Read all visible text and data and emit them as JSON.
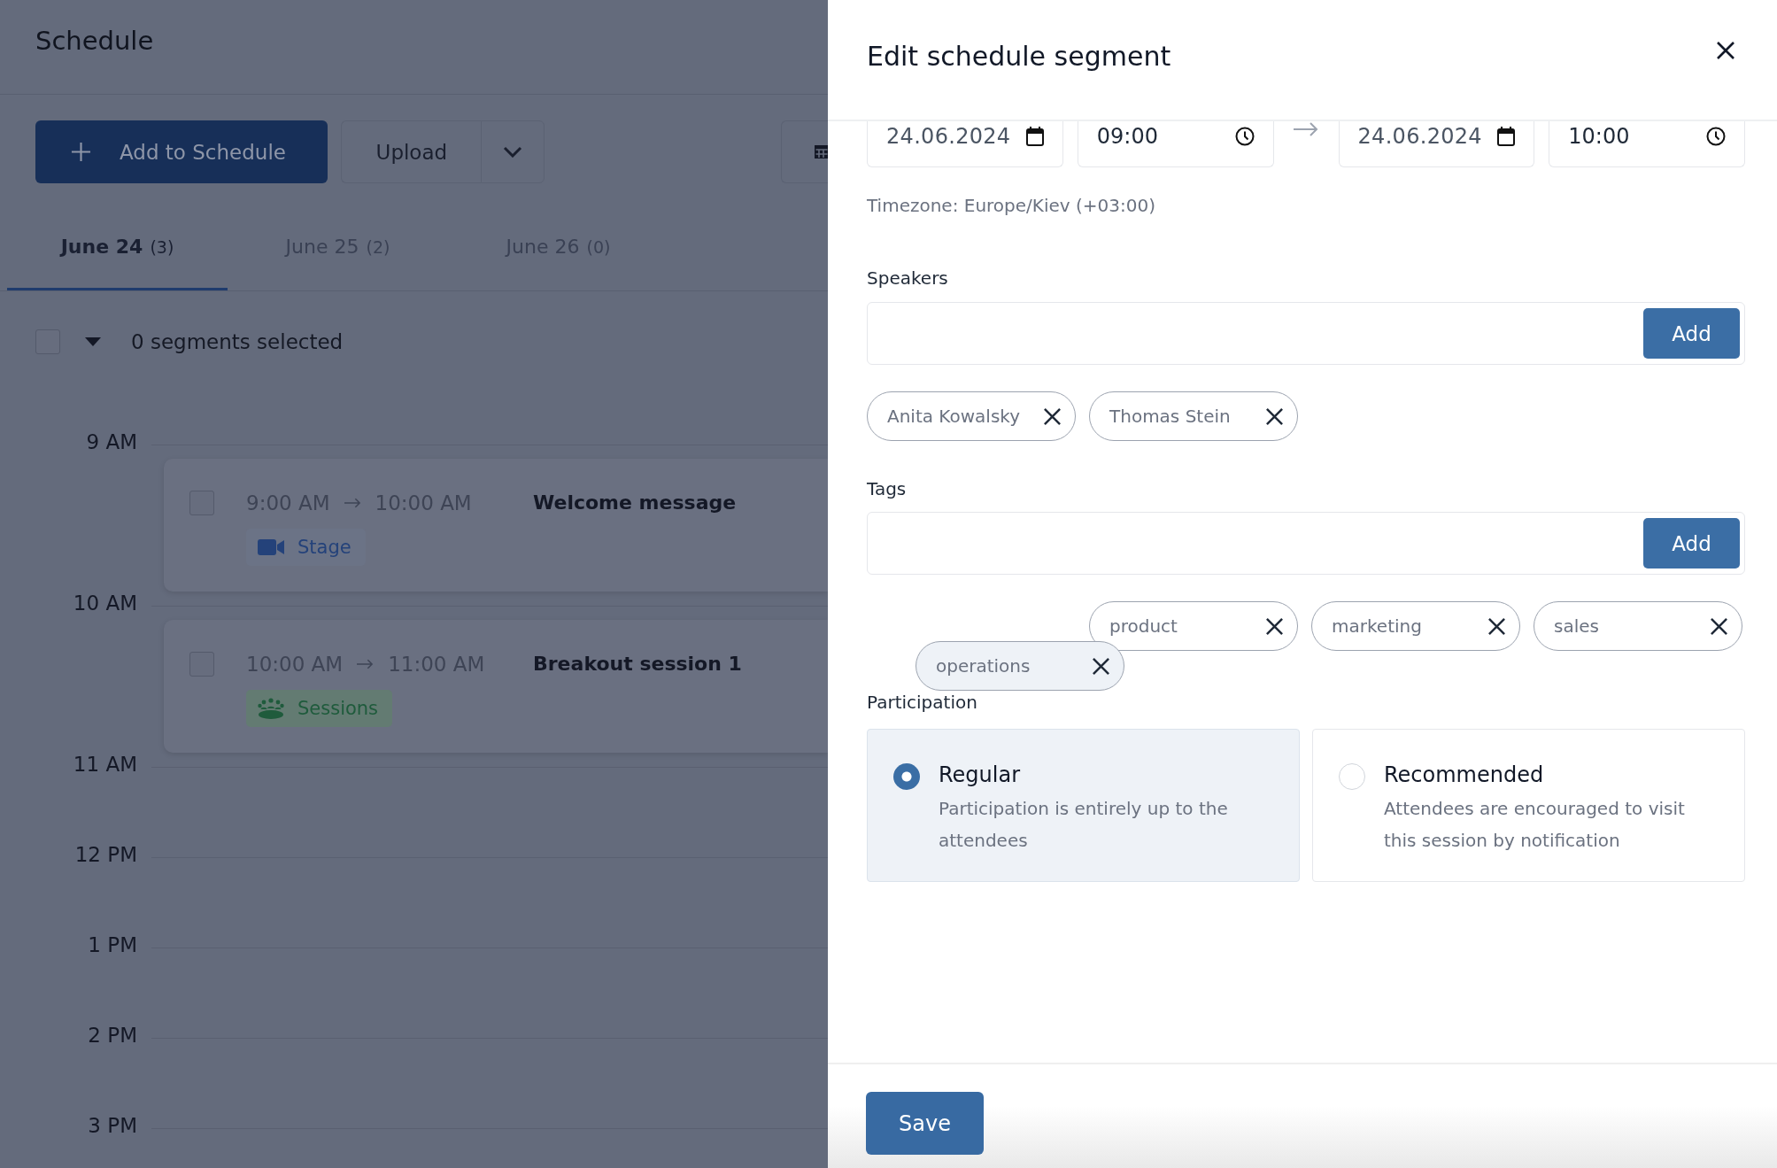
{
  "schedule": {
    "title": "Schedule",
    "add_button": "Add to Schedule",
    "upload_button": "Upload",
    "tabs": [
      {
        "label": "June 24",
        "count": "(3)",
        "selected": true
      },
      {
        "label": "June 25",
        "count": "(2)",
        "selected": false
      },
      {
        "label": "June 26",
        "count": "(0)",
        "selected": false
      }
    ],
    "selection": {
      "checked": false,
      "text": "0 segments selected"
    },
    "hours": [
      {
        "label": "9 AM",
        "segments": [
          {
            "checked": false,
            "start": "9:00 AM",
            "end": "10:00 AM",
            "title": "Welcome message",
            "tag": {
              "kind": "stage",
              "label": "Stage"
            }
          }
        ]
      },
      {
        "label": "10 AM",
        "segments": [
          {
            "checked": false,
            "start": "10:00 AM",
            "end": "11:00 AM",
            "title": "Breakout session 1",
            "tag": {
              "kind": "sessions",
              "label": "Sessions"
            }
          }
        ]
      },
      {
        "label": "11 AM"
      },
      {
        "label": "12 PM"
      },
      {
        "label": "1 PM"
      },
      {
        "label": "2 PM"
      },
      {
        "label": "3 PM"
      }
    ]
  },
  "dialog": {
    "title": "Edit schedule segment",
    "start_date": "24.06.2024",
    "start_time": "09:00",
    "end_date": "24.06.2024",
    "end_time": "10:00",
    "timezone": "Timezone: Europe/Kiev (+03:00)",
    "speakers": {
      "label": "Speakers",
      "add_button": "Add",
      "items": [
        {
          "label": "Anita Kowalsky"
        },
        {
          "label": "Thomas Stein"
        }
      ]
    },
    "tags": {
      "label": "Tags",
      "add_button": "Add",
      "items": [
        {
          "label": "operations",
          "dragging": true
        },
        {
          "label": "product",
          "dragging": false
        },
        {
          "label": "marketing",
          "dragging": false
        },
        {
          "label": "sales",
          "dragging": false
        }
      ]
    },
    "participation": {
      "label": "Participation",
      "options": [
        {
          "title": "Regular",
          "description": "Participation is entirely up to the attendees",
          "selected": true
        },
        {
          "title": "Recommended",
          "description": "Attendees are encouraged to visit this session by notification",
          "selected": false
        }
      ]
    },
    "save_button": "Save"
  }
}
